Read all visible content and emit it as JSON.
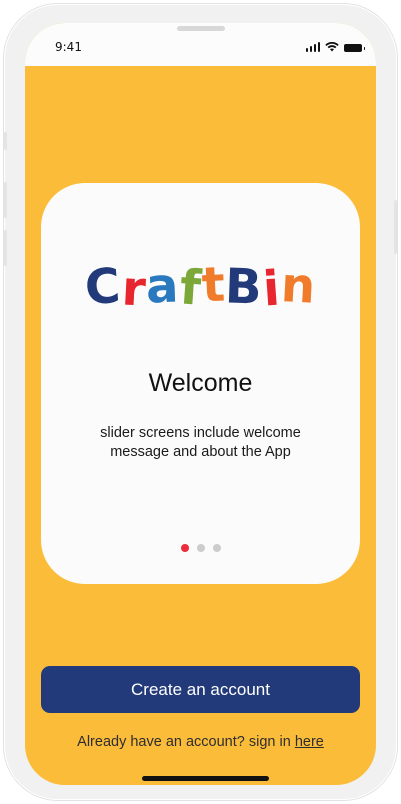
{
  "status_bar": {
    "time": "9:41",
    "icons": [
      "signal-icon",
      "wifi-icon",
      "battery-icon"
    ]
  },
  "card": {
    "logo_text": "CraftBin",
    "logo_letters": [
      {
        "char": "C",
        "color": "#223a7a"
      },
      {
        "char": "r",
        "color": "#e8262f"
      },
      {
        "char": "a",
        "color": "#2a78be"
      },
      {
        "char": "f",
        "color": "#7ca83a"
      },
      {
        "char": "t",
        "color": "#f07b2a"
      },
      {
        "char": "B",
        "color": "#223a7a"
      },
      {
        "char": "i",
        "color": "#e8262f"
      },
      {
        "char": "n",
        "color": "#f07b2a"
      }
    ],
    "title": "Welcome",
    "description": "slider screens include welcome message and about the App",
    "pager": {
      "count": 3,
      "active_index": 0
    }
  },
  "actions": {
    "create_account_label": "Create an account",
    "signin_prompt": "Already have an account? sign in",
    "signin_link": "here"
  },
  "colors": {
    "background": "#fbbc3a",
    "card": "#fbfbfb",
    "primary_button": "#22397a",
    "active_dot": "#ee2b3a",
    "inactive_dot": "#cccccc"
  }
}
